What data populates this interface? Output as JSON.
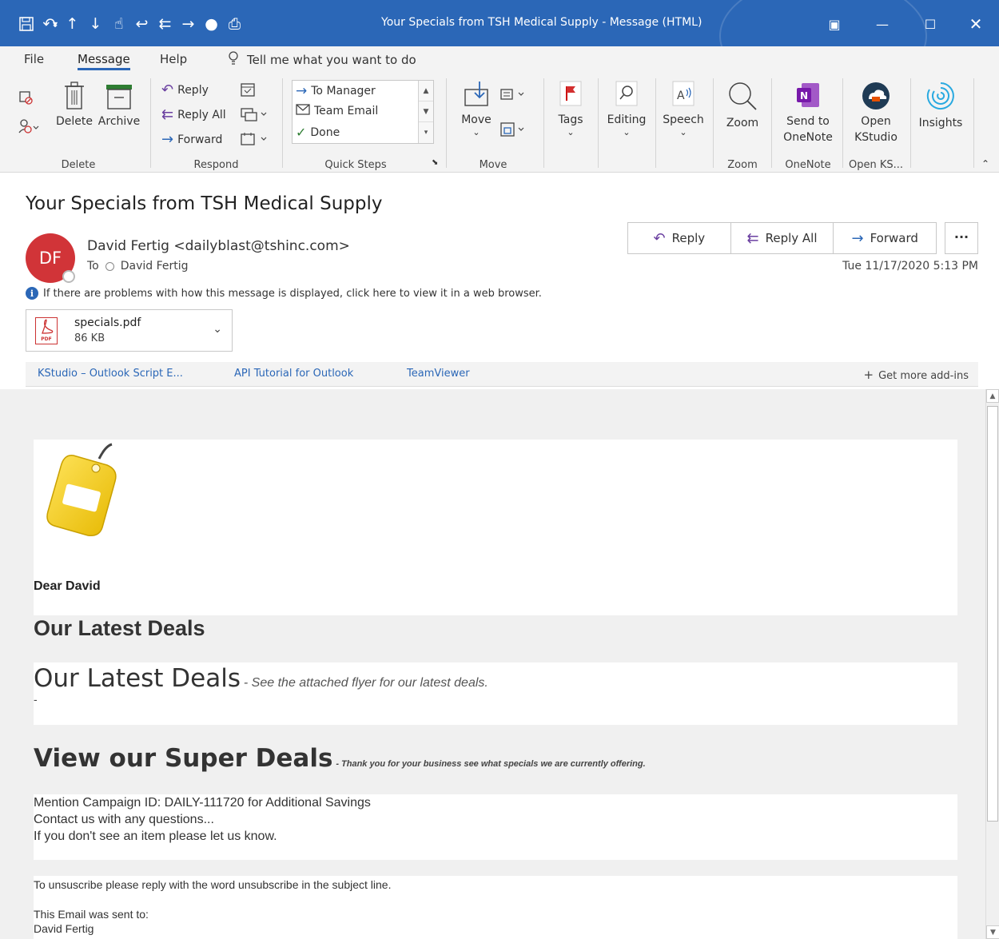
{
  "window": {
    "title": "Your Specials from TSH Medical Supply  -  Message (HTML)",
    "accent_color": "#2b67b7"
  },
  "ribbon_tabs": [
    "File",
    "Message",
    "Help"
  ],
  "tell_me": "Tell me what you want to do",
  "ribbon": {
    "delete_group": {
      "delete": "Delete",
      "archive": "Archive",
      "label": "Delete"
    },
    "respond_group": {
      "reply": "Reply",
      "reply_all": "Reply All",
      "forward": "Forward",
      "label": "Respond"
    },
    "quick_steps": {
      "items": [
        "To Manager",
        "Team Email",
        "Done"
      ],
      "label": "Quick Steps"
    },
    "move_group": {
      "move": "Move",
      "label": "Move"
    },
    "tags": "Tags",
    "editing": "Editing",
    "speech": "Speech",
    "zoom_group": {
      "zoom": "Zoom",
      "label": "Zoom"
    },
    "onenote_group": {
      "line1": "Send to",
      "line2": "OneNote",
      "label": "OneNote"
    },
    "kstudio_group": {
      "line1": "Open",
      "line2": "KStudio",
      "label": "Open KS..."
    },
    "insights": "Insights"
  },
  "message": {
    "subject": "Your Specials from TSH Medical Supply",
    "avatar_initials": "DF",
    "sender": "David Fertig <dailyblast@tshinc.com>",
    "to_label": "To",
    "to_name": "David Fertig",
    "datetime": "Tue 11/17/2020 5:13 PM",
    "actions": {
      "reply": "Reply",
      "reply_all": "Reply All",
      "forward": "Forward",
      "more": "···"
    },
    "info": "If there are problems with how this message is displayed, click here to view it in a web browser.",
    "attachment": {
      "name": "specials.pdf",
      "size": "86 KB",
      "type_label": "PDF"
    },
    "addins": [
      "KStudio – Outlook Script E...",
      "API Tutorial for Outlook",
      "TeamViewer"
    ],
    "get_more_addins": "Get more add-ins"
  },
  "body": {
    "greeting": "Dear David",
    "heading1": "Our Latest Deals",
    "heading2": "Our Latest Deals",
    "heading2_sub": "- See the attached flyer for our latest deals.",
    "dash": "-",
    "heading3": "View our Super Deals",
    "heading3_sub": "- Thank you for your business see what specials we are currently offering.",
    "lines": [
      "Mention Campaign ID: DAILY-111720 for Additional Savings",
      "Contact us with any questions...",
      "If you don't see an item please let us know."
    ],
    "unsubscribe": "To unsuscribe please reply with the word unsubscribe in the subject line.",
    "sent_to_label": "This Email was sent to:",
    "sent_to_name": "David Fertig"
  }
}
